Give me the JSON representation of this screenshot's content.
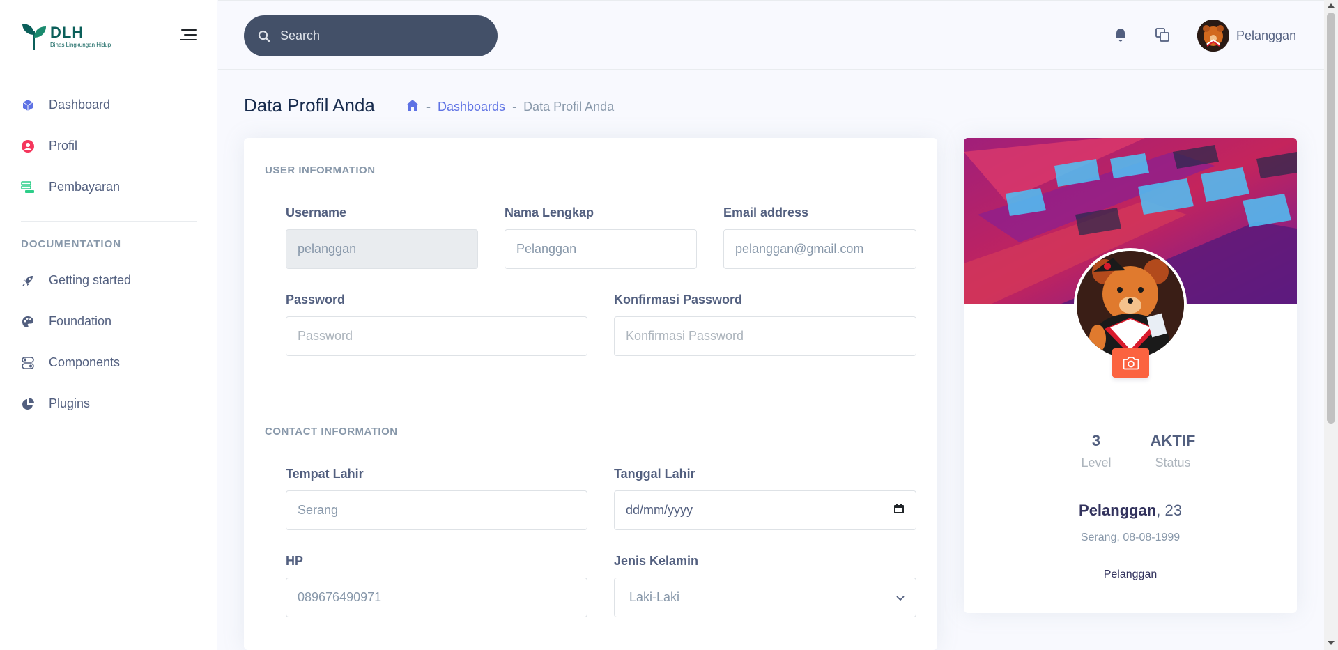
{
  "brand": {
    "title": "DLH",
    "subtitle": "Dinas Lingkungan Hidup"
  },
  "sidebar": {
    "items": [
      {
        "label": "Dashboard",
        "icon": "cube-icon",
        "color": "#5e72e4"
      },
      {
        "label": "Profil",
        "icon": "user-circle-icon",
        "color": "#f5365c"
      },
      {
        "label": "Pembayaran",
        "icon": "database-icon",
        "color": "#2dce89"
      }
    ],
    "doc_heading": "DOCUMENTATION",
    "doc_items": [
      {
        "label": "Getting started",
        "icon": "rocket-icon"
      },
      {
        "label": "Foundation",
        "icon": "palette-icon"
      },
      {
        "label": "Components",
        "icon": "components-icon"
      },
      {
        "label": "Plugins",
        "icon": "pie-chart-icon"
      }
    ]
  },
  "topbar": {
    "search_placeholder": "Search",
    "user_name": "Pelanggan"
  },
  "header": {
    "title": "Data Profil Anda",
    "breadcrumb": [
      "Dashboards",
      "Data Profil Anda"
    ]
  },
  "form": {
    "user_section": "USER INFORMATION",
    "contact_section": "CONTACT INFORMATION",
    "username": {
      "label": "Username",
      "value": "pelanggan"
    },
    "nama": {
      "label": "Nama Lengkap",
      "value": "Pelanggan"
    },
    "email": {
      "label": "Email address",
      "value": "pelanggan@gmail.com"
    },
    "password": {
      "label": "Password",
      "placeholder": "Password"
    },
    "konfirmasi": {
      "label": "Konfirmasi Password",
      "placeholder": "Konfirmasi Password"
    },
    "tempat": {
      "label": "Tempat Lahir",
      "value": "Serang"
    },
    "tanggal": {
      "label": "Tanggal Lahir",
      "placeholder": "dd/mm/yyyy"
    },
    "hp": {
      "label": "HP",
      "value": "089676490971"
    },
    "jenis": {
      "label": "Jenis Kelamin",
      "value": "Laki-Laki"
    }
  },
  "profile": {
    "level_value": "3",
    "level_label": "Level",
    "status_value": "AKTIF",
    "status_label": "Status",
    "name": "Pelanggan",
    "age": ", 23",
    "birth": "Serang, 08-08-1999",
    "role": "Pelanggan"
  },
  "colors": {
    "primary": "#5e72e4",
    "danger": "#f5365c",
    "success": "#2dce89",
    "warning": "#fb6340",
    "search_bg": "#435068"
  }
}
